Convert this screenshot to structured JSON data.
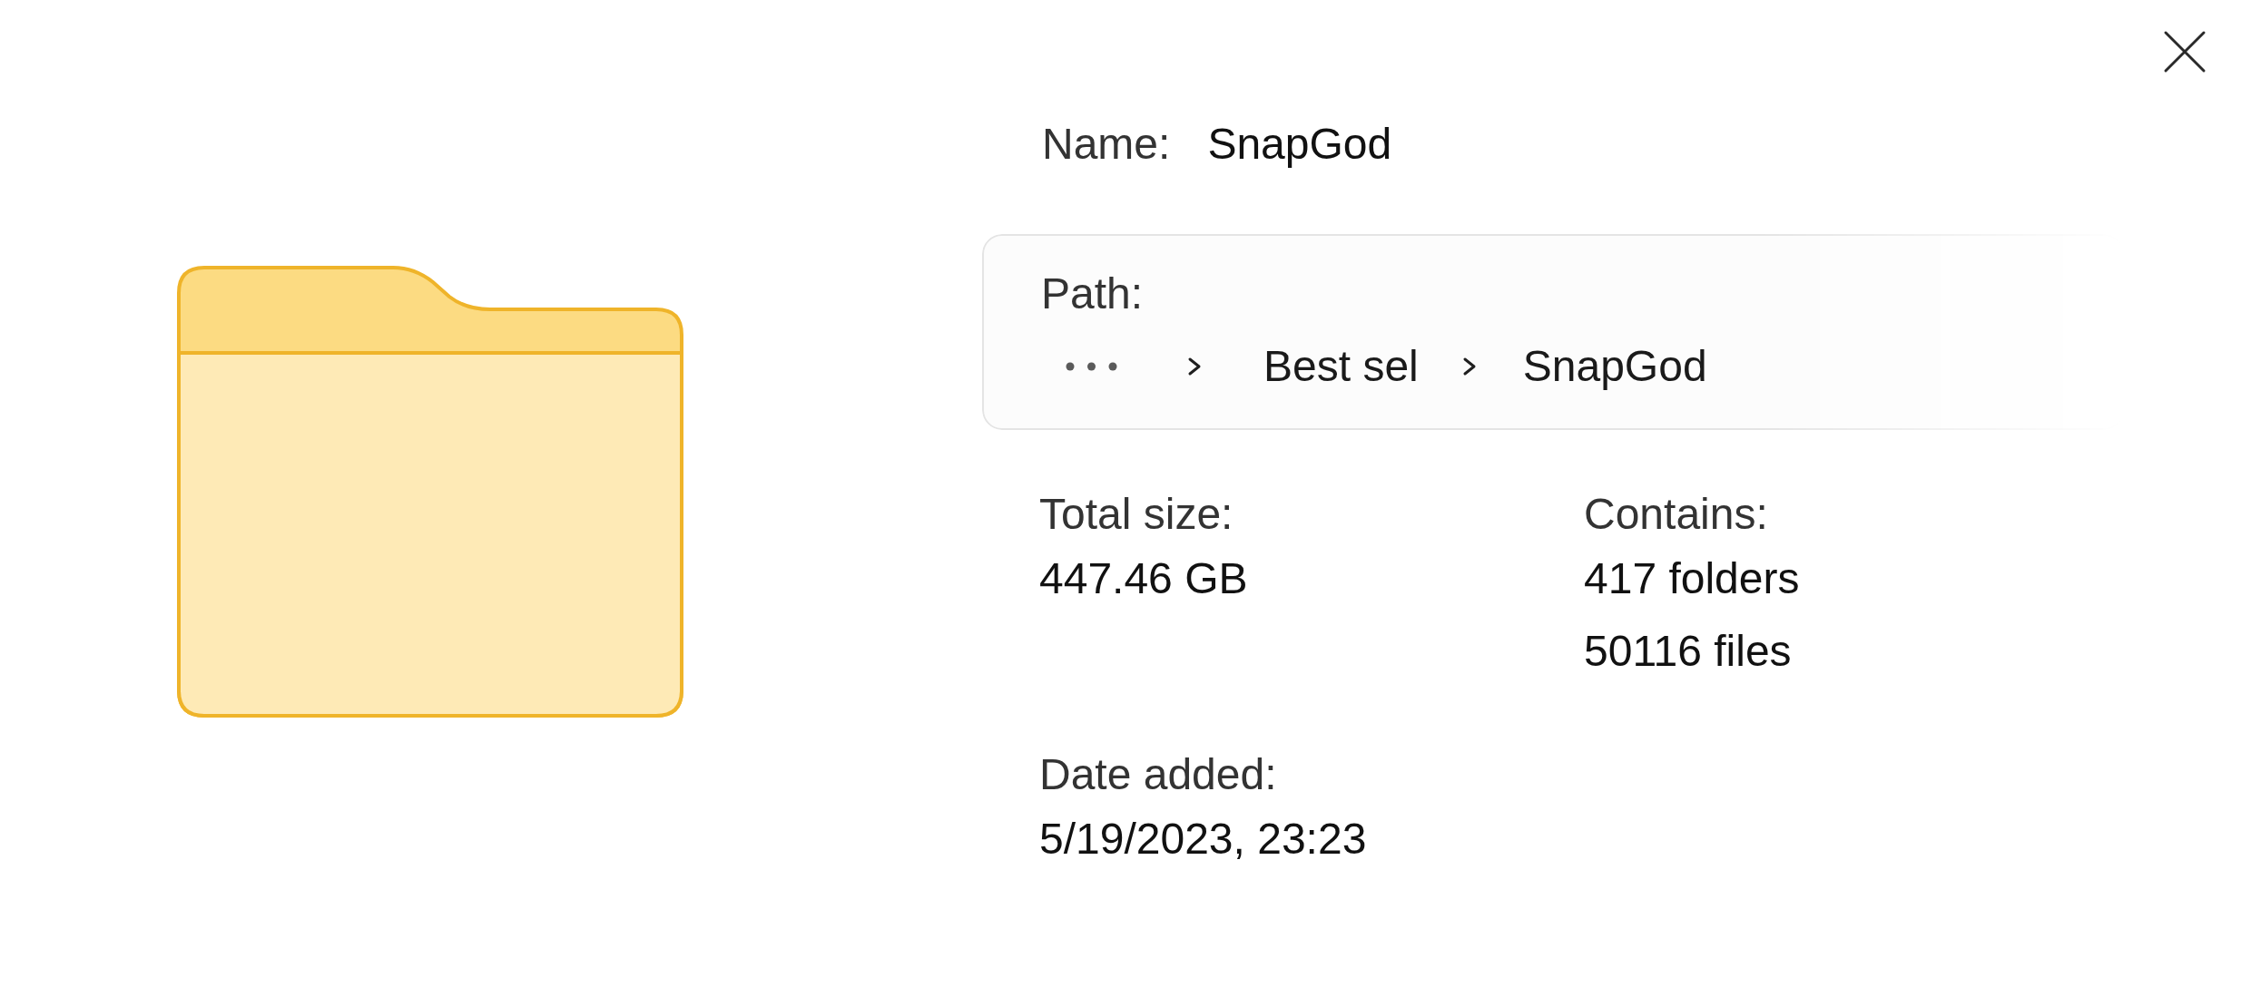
{
  "name": {
    "label": "Name:",
    "value": "SnapGod"
  },
  "path": {
    "label": "Path:",
    "segments": [
      {
        "kind": "overflow"
      },
      {
        "kind": "folder",
        "text": "Best sel"
      },
      {
        "kind": "folder",
        "text": "SnapGod"
      }
    ]
  },
  "properties": [
    {
      "label": "Total size:",
      "values": [
        "447.46 GB"
      ]
    },
    {
      "label": "Contains:",
      "values": [
        "417 folders",
        "50116 files"
      ]
    },
    {
      "label": "Date added:",
      "values": [
        "5/19/2023, 23:23"
      ]
    }
  ]
}
